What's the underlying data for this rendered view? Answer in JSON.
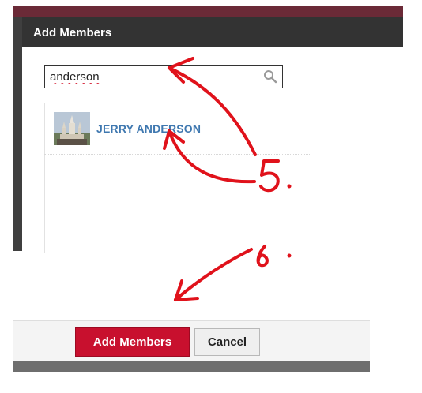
{
  "dialog": {
    "title": "Add Members"
  },
  "search": {
    "value": "anderson",
    "icon": "search-icon"
  },
  "results": [
    {
      "name": "JERRY ANDERSON",
      "avatar_icon": "castle-photo"
    }
  ],
  "footer": {
    "add_label": "Add Members",
    "cancel_label": "Cancel"
  },
  "annotations": {
    "step_five": "5.",
    "step_six": "6.",
    "ink_color": "#e0121b"
  },
  "colors": {
    "title_bar": "#333333",
    "top_strip": "#6b2a37",
    "primary_button": "#c8102e",
    "link_blue": "#3f78b0"
  }
}
